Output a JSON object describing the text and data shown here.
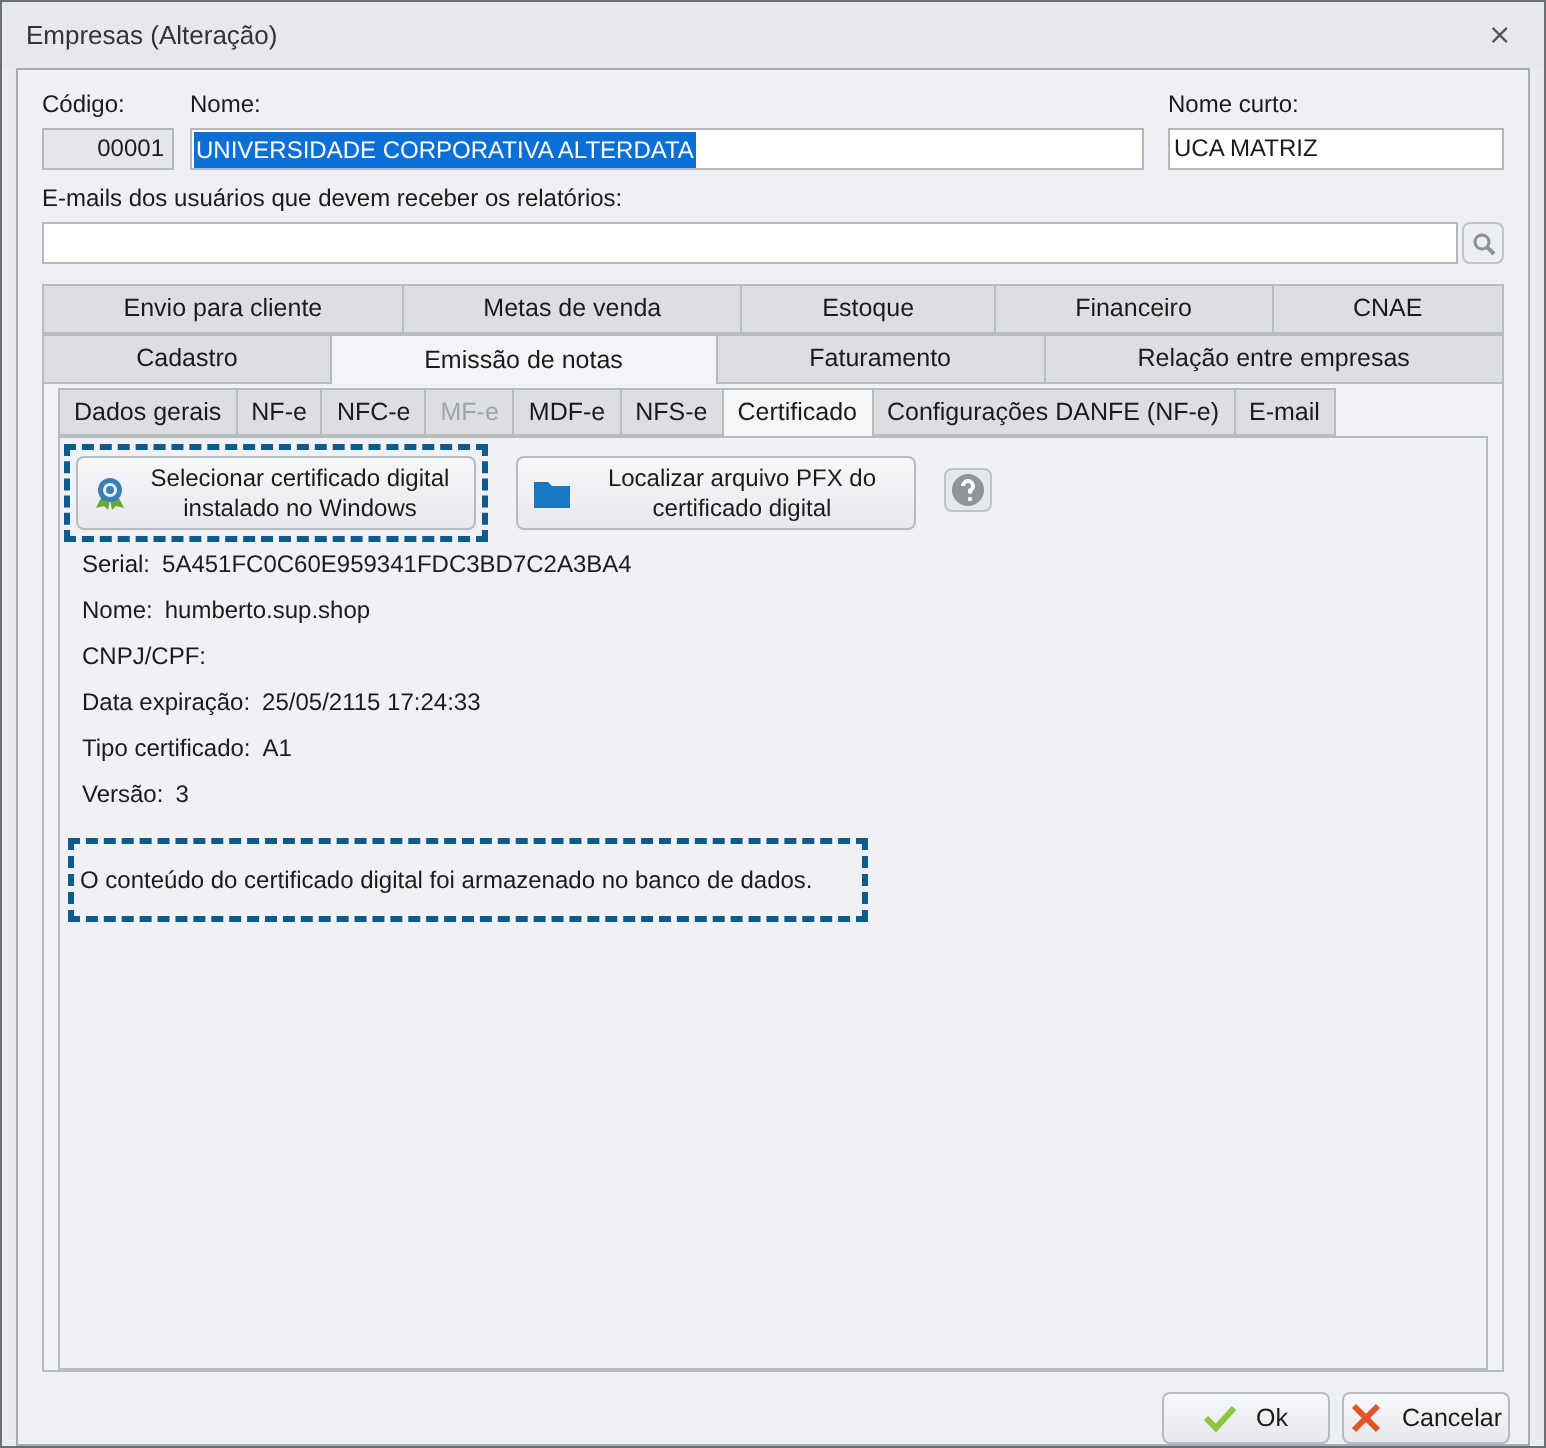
{
  "window": {
    "title": "Empresas (Alteração)",
    "close": "⨯"
  },
  "fields": {
    "codigo": {
      "label": "Código:",
      "value": "00001"
    },
    "nome": {
      "label": "Nome:",
      "value": "UNIVERSIDADE CORPORATIVA ALTERDATA"
    },
    "nome_curto": {
      "label": "Nome curto:",
      "value": "UCA MATRIZ"
    },
    "emails": {
      "label": "E-mails dos usuários que devem receber os relatórios:"
    }
  },
  "tab_rows": [
    [
      {
        "label": "Envio para cliente",
        "selected": false
      },
      {
        "label": "Metas de venda",
        "selected": false
      },
      {
        "label": "Estoque",
        "selected": false
      },
      {
        "label": "Financeiro",
        "selected": false
      },
      {
        "label": "CNAE",
        "selected": false
      }
    ],
    [
      {
        "label": "Cadastro",
        "selected": false
      },
      {
        "label": "Emissão de notas",
        "selected": true
      },
      {
        "label": "Faturamento",
        "selected": false
      },
      {
        "label": "Relação entre empresas",
        "selected": false
      }
    ]
  ],
  "subtabs": [
    {
      "label": "Dados gerais",
      "selected": false,
      "disabled": false
    },
    {
      "label": "NF-e",
      "selected": false,
      "disabled": false
    },
    {
      "label": "NFC-e",
      "selected": false,
      "disabled": false
    },
    {
      "label": "MF-e",
      "selected": false,
      "disabled": true
    },
    {
      "label": "MDF-e",
      "selected": false,
      "disabled": false
    },
    {
      "label": "NFS-e",
      "selected": false,
      "disabled": false
    },
    {
      "label": "Certificado",
      "selected": true,
      "disabled": false
    },
    {
      "label": "Configurações DANFE (NF-e)",
      "selected": false,
      "disabled": false
    },
    {
      "label": "E-mail",
      "selected": false,
      "disabled": false
    }
  ],
  "buttons": [
    {
      "kind": "certificate",
      "label": "Selecionar certificado digital instalado no Windows",
      "highlighted": true
    },
    {
      "kind": "folder",
      "label": "Localizar arquivo PFX do certificado digital",
      "highlighted": false
    }
  ],
  "info": [
    {
      "label": "Serial:",
      "value": "5A451FC0C60E959341FDC3BD7C2A3BA4"
    },
    {
      "label": "Nome:",
      "value": "humberto.sup.shop"
    },
    {
      "label": "CNPJ/CPF:"
    },
    {
      "label": "Data expiração:",
      "value": "25/05/2115 17:24:33"
    },
    {
      "label": "Tipo certificado:",
      "value": "A1"
    },
    {
      "label": "Versão:",
      "value": "3"
    }
  ],
  "message": {
    "text": "O conteúdo do certificado digital foi armazenado no banco de dados.",
    "highlighted": true
  },
  "footer": [
    {
      "kind": "ok",
      "label": "Ok"
    },
    {
      "kind": "cancel",
      "label": "Cancelar"
    }
  ]
}
